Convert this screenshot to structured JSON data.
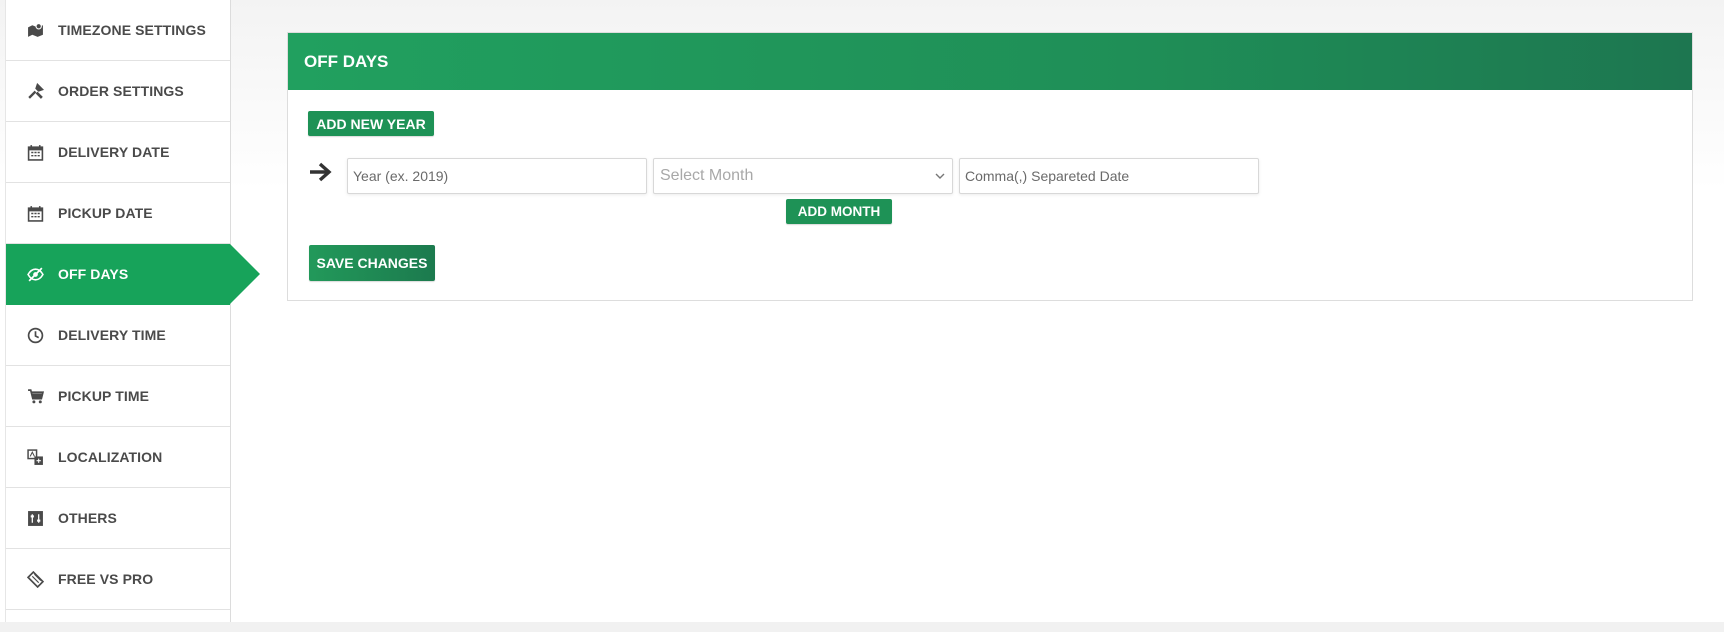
{
  "sidebar": {
    "items": [
      {
        "label": "TIMEZONE SETTINGS",
        "icon": "map-pin-icon"
      },
      {
        "label": "ORDER SETTINGS",
        "icon": "tools-icon"
      },
      {
        "label": "DELIVERY DATE",
        "icon": "calendar-icon"
      },
      {
        "label": "PICKUP DATE",
        "icon": "calendar-icon"
      },
      {
        "label": "OFF DAYS",
        "icon": "eye-slash-icon"
      },
      {
        "label": "DELIVERY TIME",
        "icon": "clock-icon"
      },
      {
        "label": "PICKUP TIME",
        "icon": "cart-icon"
      },
      {
        "label": "LOCALIZATION",
        "icon": "translate-icon"
      },
      {
        "label": "OTHERS",
        "icon": "sliders-icon"
      },
      {
        "label": "FREE VS PRO",
        "icon": "ticket-icon"
      }
    ],
    "active_index": 4
  },
  "panel": {
    "title": "OFF DAYS",
    "add_year_label": "ADD NEW YEAR",
    "year_placeholder": "Year (ex. 2019)",
    "month_placeholder": "Select Month",
    "dates_placeholder": "Comma(,) Separeted Date",
    "add_month_label": "ADD MONTH",
    "save_label": "SAVE CHANGES"
  },
  "colors": {
    "accent": "#17a35a",
    "button": "#1e9256"
  }
}
